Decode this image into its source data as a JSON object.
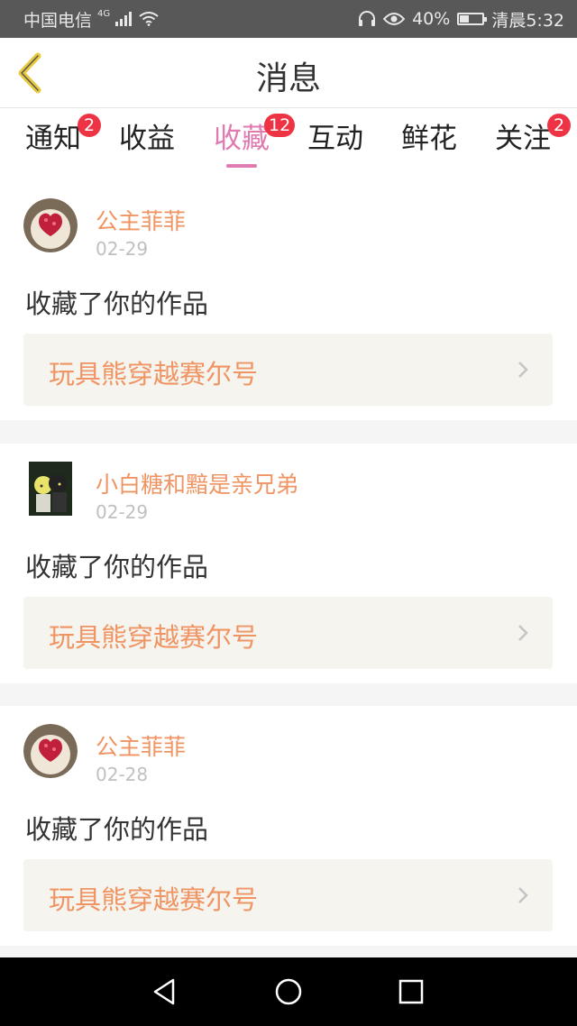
{
  "status_bar": {
    "carrier": "中国电信",
    "network": "4G",
    "battery": "40%",
    "battery_level": 0.4,
    "time": "清晨5:32"
  },
  "header": {
    "title": "消息"
  },
  "tabs": [
    {
      "label": "通知",
      "badge": "2",
      "active": false
    },
    {
      "label": "收益",
      "badge": "",
      "active": false
    },
    {
      "label": "收藏",
      "badge": "12",
      "active": true
    },
    {
      "label": "互动",
      "badge": "",
      "active": false
    },
    {
      "label": "鲜花",
      "badge": "",
      "active": false
    },
    {
      "label": "关注",
      "badge": "2",
      "active": false
    }
  ],
  "feed": [
    {
      "user": "公主菲菲",
      "date": "02-29",
      "action": "收藏了你的作品",
      "work": "玩具熊穿越赛尔号",
      "avatar": "cupcake-avatar"
    },
    {
      "user": "小白糖和黯是亲兄弟",
      "date": "02-29",
      "action": "收藏了你的作品",
      "work": "玩具熊穿越赛尔号",
      "avatar": "anime-avatar"
    },
    {
      "user": "公主菲菲",
      "date": "02-28",
      "action": "收藏了你的作品",
      "work": "玩具熊穿越赛尔号",
      "avatar": "cupcake-avatar"
    }
  ],
  "colors": {
    "accent_pink": "#e07bb1",
    "name_orange": "#ef9462",
    "badge_red": "#ee3344",
    "back_yellow": "#e8c940"
  },
  "nav": {
    "back": "back-triangle-icon",
    "home": "home-circle-icon",
    "recents": "recents-square-icon"
  }
}
